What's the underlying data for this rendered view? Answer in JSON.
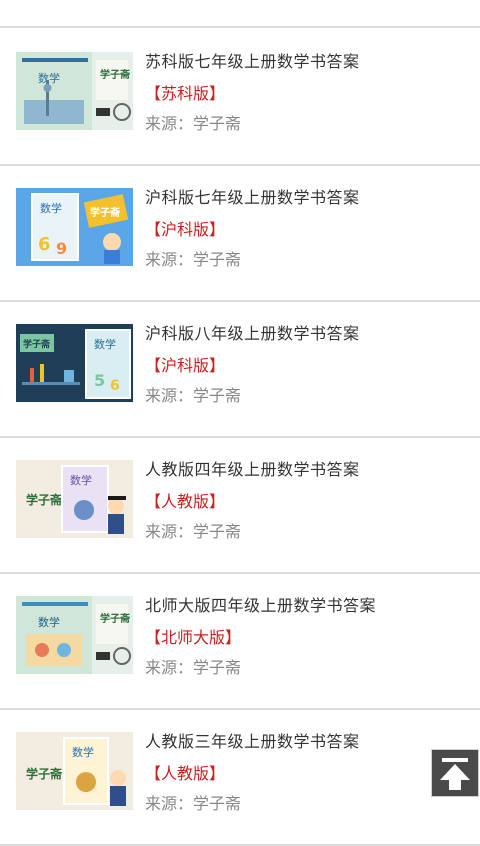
{
  "items": [
    {
      "title": "苏科版七年级上册数学书答案",
      "edition": "【苏科版】",
      "source": "来源：学子斋",
      "cover": {
        "subject": "数学",
        "brand": "学子斋",
        "bg": "#cfe6d8",
        "accent": "#2f6f9a"
      }
    },
    {
      "title": "沪科版七年级上册数学书答案",
      "edition": "【沪科版】",
      "source": "来源：学子斋",
      "cover": {
        "subject": "数学",
        "brand": "学子斋",
        "bg": "#5aa6e6",
        "accent": "#f2c12e"
      }
    },
    {
      "title": "沪科版八年级上册数学书答案",
      "edition": "【沪科版】",
      "source": "来源：学子斋",
      "cover": {
        "subject": "数学",
        "brand": "学子斋",
        "bg": "#1f3e57",
        "accent": "#7cc6a0"
      }
    },
    {
      "title": "人教版四年级上册数学书答案",
      "edition": "【人教版】",
      "source": "来源：学子斋",
      "cover": {
        "subject": "数学",
        "brand": "学子斋",
        "bg": "#f3ece0",
        "accent": "#6b8fc7"
      }
    },
    {
      "title": "北师大版四年级上册数学书答案",
      "edition": "【北师大版】",
      "source": "来源：学子斋",
      "cover": {
        "subject": "数学",
        "brand": "学子斋",
        "bg": "#cfe6d8",
        "accent": "#3a8fc0"
      }
    },
    {
      "title": "人教版三年级上册数学书答案",
      "edition": "【人教版】",
      "source": "来源：学子斋",
      "cover": {
        "subject": "数学",
        "brand": "学子斋",
        "bg": "#f3ece0",
        "accent": "#d9a441"
      }
    }
  ],
  "back_to_top": {
    "icon": "arrow-up-to-line-icon"
  }
}
